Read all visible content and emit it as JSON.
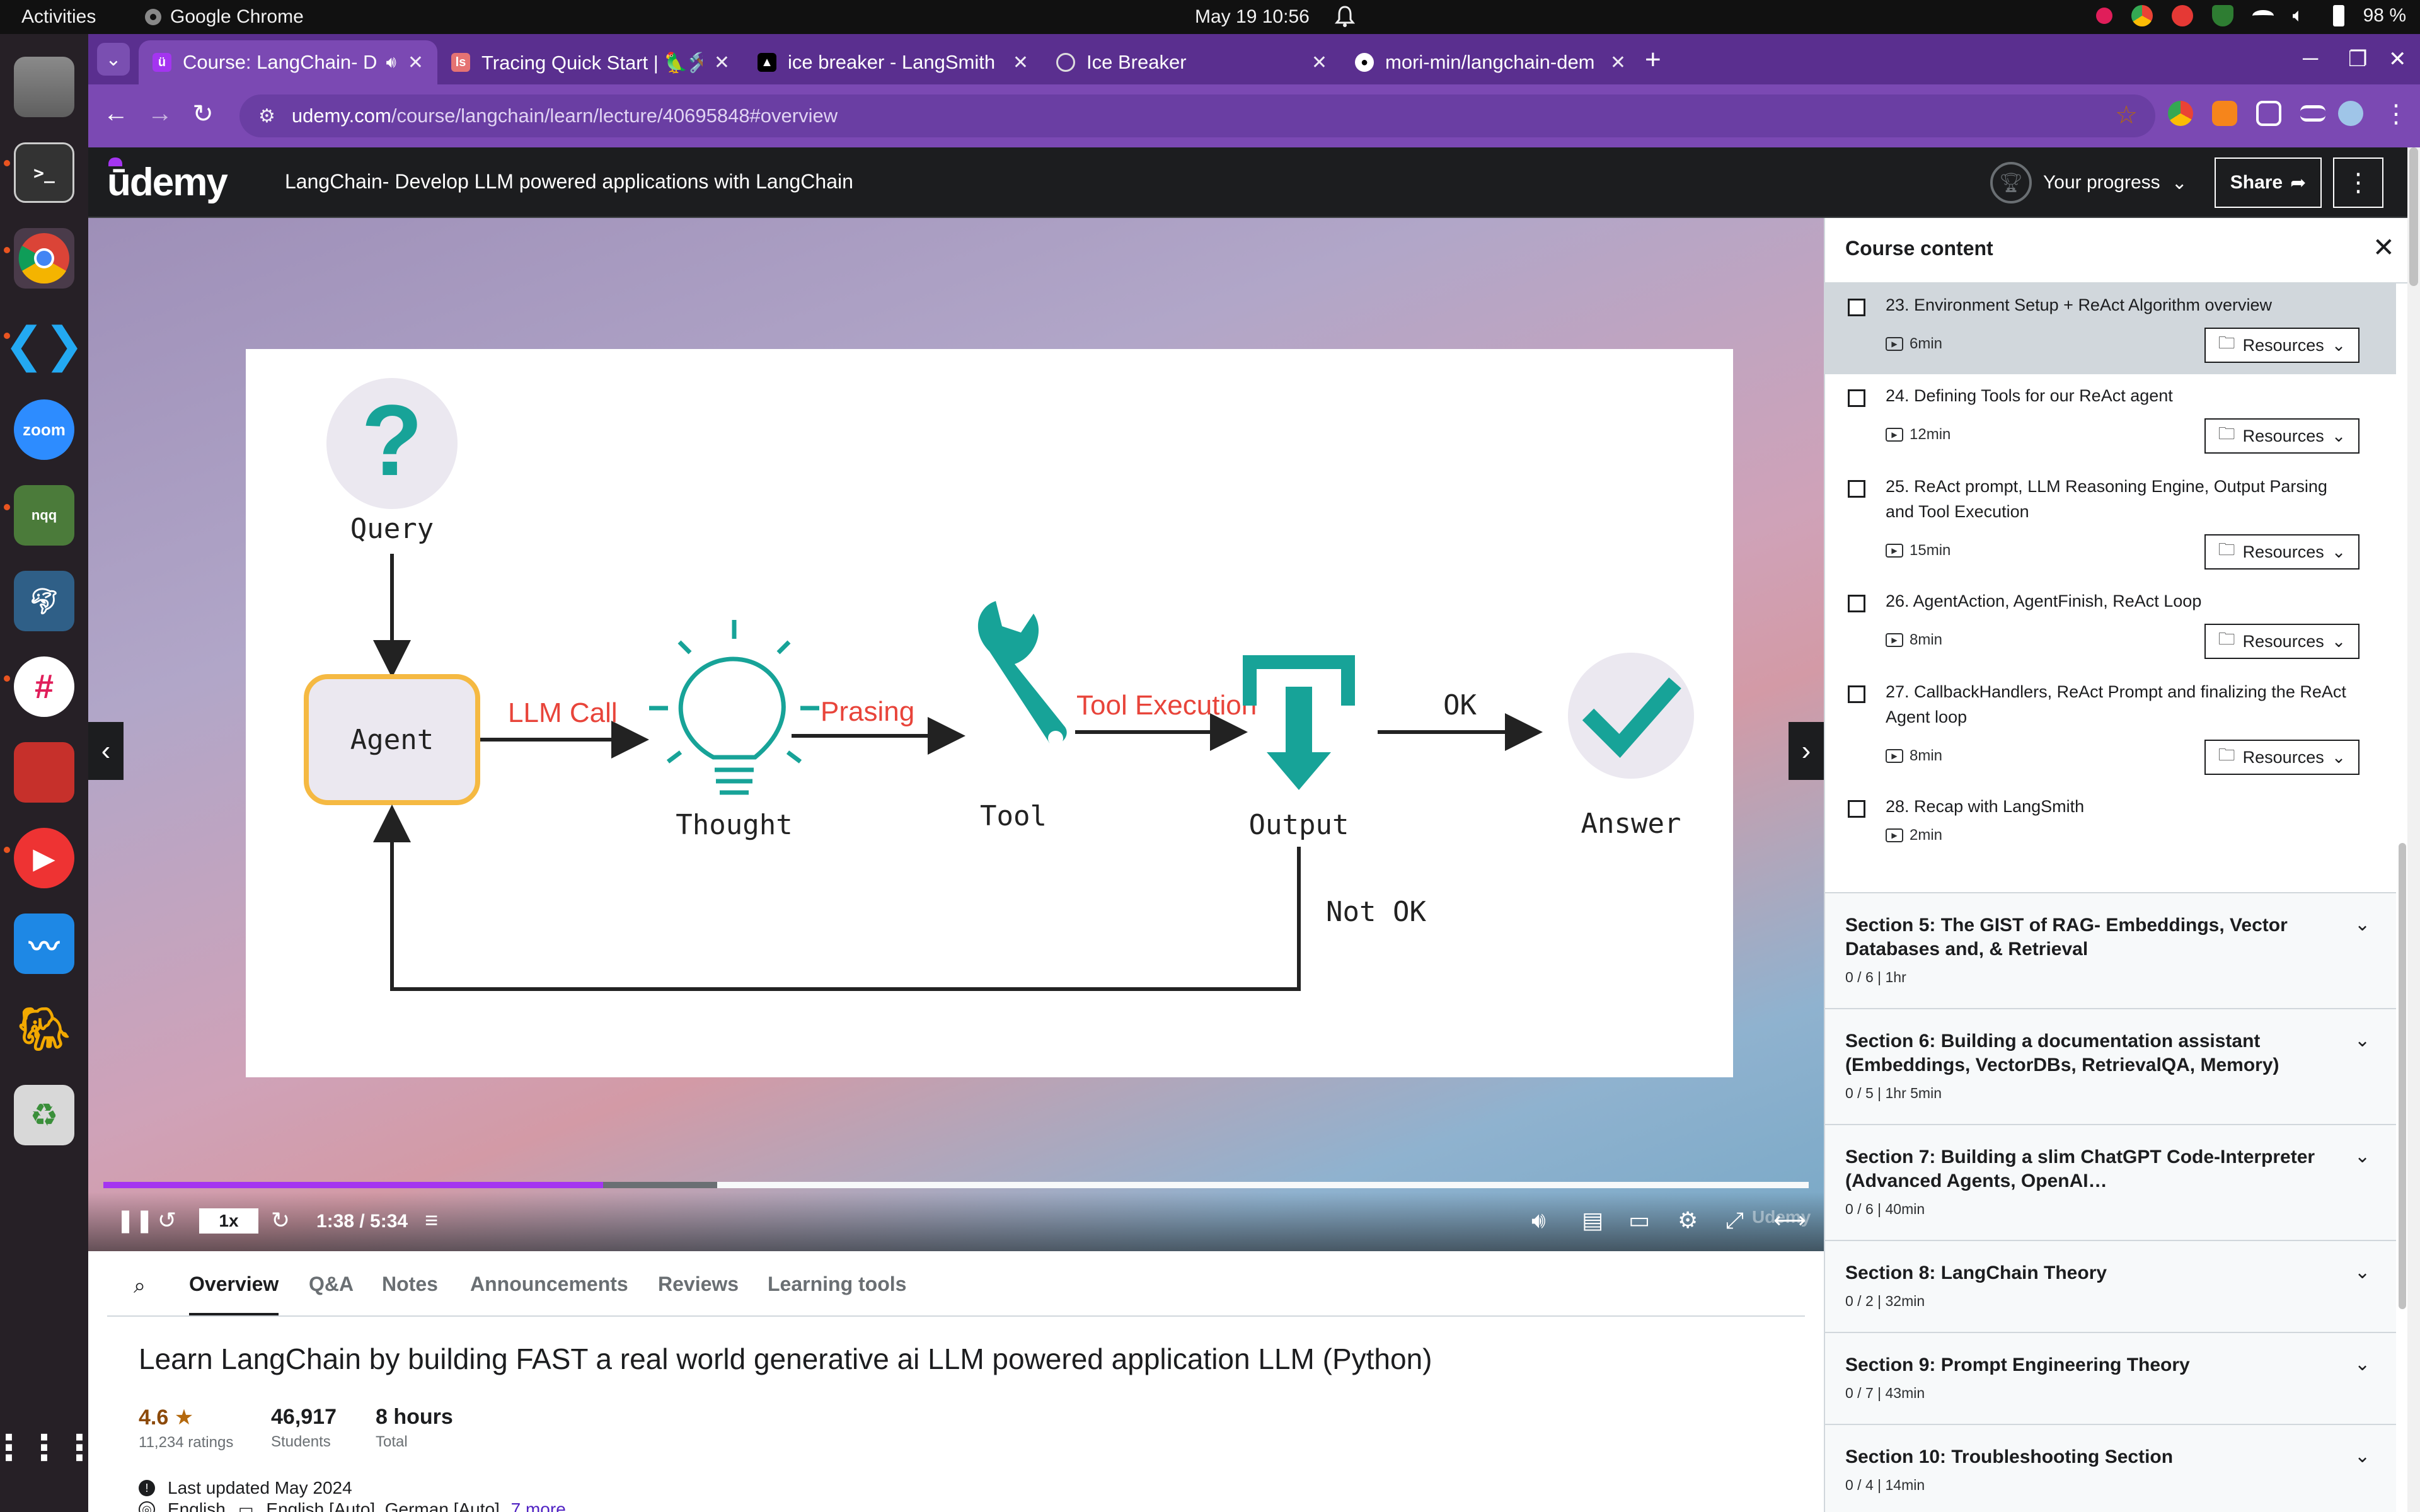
{
  "os": {
    "activities": "Activities",
    "app_name": "Google Chrome",
    "clock": "May 19  10:56",
    "battery": "98 %"
  },
  "browser": {
    "tabs": [
      {
        "label": "Course: LangChain- D",
        "active": true
      },
      {
        "label": "Tracing Quick Start | 🦜🛠️",
        "active": false
      },
      {
        "label": "ice breaker - LangSmith",
        "active": false
      },
      {
        "label": "Ice Breaker",
        "active": false
      },
      {
        "label": "mori-min/langchain-dem",
        "active": false
      }
    ],
    "url_domain": "udemy.com",
    "url_path": "/course/langchain/learn/lecture/40695848#overview"
  },
  "udemy": {
    "logo": "ūdemy",
    "course_title": "LangChain- Develop LLM powered applications with LangChain",
    "progress_label": "Your progress",
    "share_label": "Share"
  },
  "diagram": {
    "query": "Query",
    "agent": "Agent",
    "llm_call": "LLM Call",
    "thought": "Thought",
    "prasing": "Prasing",
    "tool": "Tool",
    "tool_execution": "Tool Execution",
    "output": "Output",
    "ok": "OK",
    "answer": "Answer",
    "not_ok": "Not OK"
  },
  "player": {
    "rate": "1x",
    "time": "1:38 / 5:34",
    "progress_fraction": 0.293,
    "buffered_fraction": 0.36,
    "watermark": "Udemy"
  },
  "lecture_tabs": [
    "Overview",
    "Q&A",
    "Notes",
    "Announcements",
    "Reviews",
    "Learning tools"
  ],
  "overview": {
    "title": "Learn LangChain by building FAST a real world generative ai LLM powered application LLM (Python)",
    "rating": "4.6",
    "ratings_count": "11,234 ratings",
    "students": "46,917",
    "students_label": "Students",
    "hours": "8 hours",
    "hours_label": "Total",
    "last_updated": "Last updated May 2024",
    "language": "English",
    "captions": "English [Auto], German [Auto],",
    "more_link": "7 more"
  },
  "sidebar": {
    "title": "Course content",
    "resources_label": "Resources",
    "lectures": [
      {
        "title": "23. Environment Setup + ReAct Algorithm overview",
        "duration": "6min",
        "resources": true,
        "current": true
      },
      {
        "title": "24. Defining Tools for our ReAct agent",
        "duration": "12min",
        "resources": true,
        "current": false
      },
      {
        "title": "25. ReAct prompt, LLM Reasoning Engine, Output Parsing and Tool Execution",
        "duration": "15min",
        "resources": true,
        "current": false
      },
      {
        "title": "26. AgentAction, AgentFinish, ReAct Loop",
        "duration": "8min",
        "resources": true,
        "current": false
      },
      {
        "title": "27. CallbackHandlers, ReAct Prompt and finalizing the ReAct Agent loop",
        "duration": "8min",
        "resources": true,
        "current": false
      },
      {
        "title": "28. Recap with LangSmith",
        "duration": "2min",
        "resources": false,
        "current": false
      }
    ],
    "sections": [
      {
        "title": "Section 5: The GIST of RAG- Embeddings, Vector Databases and, & Retrieval",
        "meta": "0 / 6 | 1hr"
      },
      {
        "title": "Section 6: Building a documentation assistant (Embeddings, VectorDBs, RetrievalQA, Memory)",
        "meta": "0 / 5 | 1hr 5min"
      },
      {
        "title": "Section 7: Building a slim ChatGPT Code-Interpreter (Advanced Agents, OpenAI…",
        "meta": "0 / 6 | 40min"
      },
      {
        "title": "Section 8: LangChain Theory",
        "meta": "0 / 2 | 32min"
      },
      {
        "title": "Section 9: Prompt Engineering Theory",
        "meta": "0 / 7 | 43min"
      },
      {
        "title": "Section 10: Troubleshooting Section",
        "meta": "0 / 4 | 14min"
      }
    ]
  },
  "colors": {
    "accent": "#a435f0",
    "chrome_frame": "#5a2f8f",
    "teal": "#17a398",
    "agent_border": "#f5b942",
    "diagram_red": "#e8443a"
  }
}
